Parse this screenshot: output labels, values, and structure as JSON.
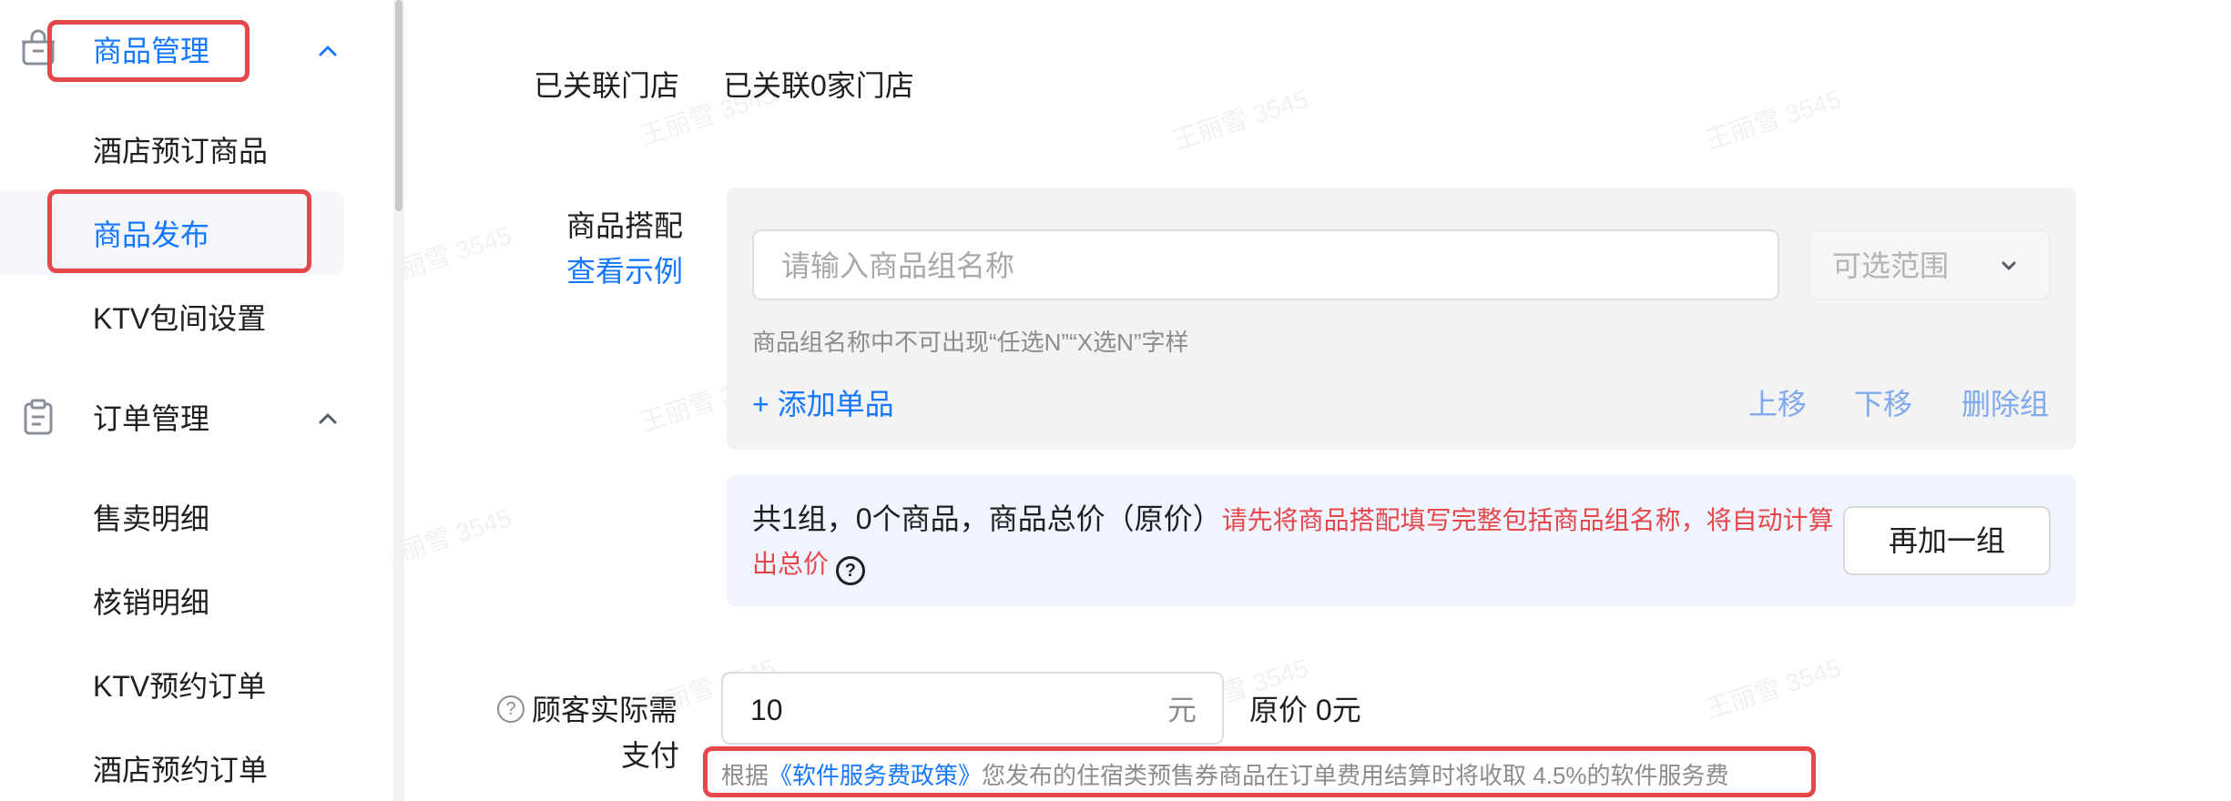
{
  "sidebar": {
    "group1": {
      "label": "商品管理",
      "icon": "shop-bag-icon",
      "chevron": "chevron-up-icon"
    },
    "group1_items": [
      {
        "label": "酒店预订商品"
      },
      {
        "label": "商品发布",
        "active": true
      },
      {
        "label": "KTV包间设置"
      }
    ],
    "group2": {
      "label": "订单管理",
      "icon": "clipboard-icon",
      "chevron": "chevron-up-icon"
    },
    "group2_items": [
      {
        "label": "售卖明细"
      },
      {
        "label": "核销明细"
      },
      {
        "label": "KTV预约订单"
      },
      {
        "label": "酒店预约订单"
      }
    ]
  },
  "form": {
    "linked_stores": {
      "label": "已关联门店",
      "value": "已关联0家门店"
    },
    "combo": {
      "label": "商品搭配",
      "example_link": "查看示例",
      "group_name_placeholder": "请输入商品组名称",
      "range_placeholder": "可选范围",
      "hint": "商品组名称中不可出现“任选N”“X选N”字样",
      "add_item": "+ 添加单品",
      "move_up": "上移",
      "move_down": "下移",
      "delete_group": "删除组"
    },
    "summary": {
      "text": "共1组，0个商品，商品总价（原价）",
      "warning_line1": "请先将商品搭配填写完整包括商品组名称，将自动计算",
      "warning_line2": "出总价",
      "help_icon": "?",
      "add_group_button": "再加一组"
    },
    "payment": {
      "help_icon": "?",
      "label_line1": "顾客实际需",
      "label_line2": "支付",
      "value": "10",
      "unit": "元",
      "original_price": "原价 0元",
      "notice_prefix": "根据",
      "notice_link": "《软件服务费政策》",
      "notice_suffix": "您发布的住宿类预售券商品在订单费用结算时将收取 4.5%的软件服务费"
    }
  },
  "watermark": {
    "text": "王丽雪 3545"
  },
  "colors": {
    "primary": "#1677ff",
    "danger": "#e5474b",
    "muted": "#8c8c8c",
    "link_light": "#7fa9ea",
    "highlight_box": "#e5474b"
  }
}
